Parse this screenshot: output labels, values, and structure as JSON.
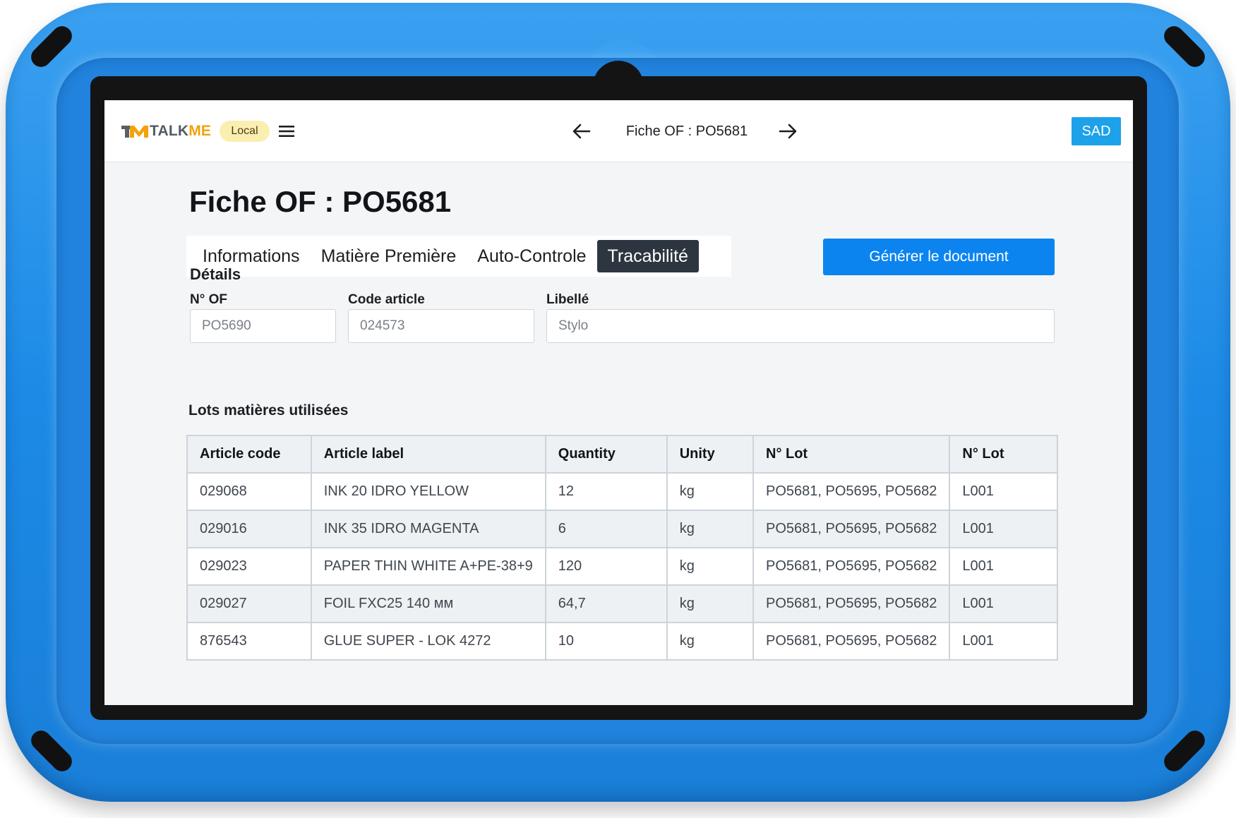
{
  "header": {
    "brand_part1": "TALK",
    "brand_part2": "ME",
    "env_badge": "Local",
    "title": "Fiche OF : PO5681",
    "user_initials": "SAD"
  },
  "page": {
    "title": "Fiche OF : PO5681",
    "tabs": [
      {
        "label": "Informations",
        "active": false
      },
      {
        "label": "Matière Première",
        "active": false
      },
      {
        "label": "Auto-Controle",
        "active": false
      },
      {
        "label": "Tracabilité",
        "active": true
      }
    ],
    "generate_button": "Générer le document"
  },
  "details": {
    "section_title": "Détails",
    "of_number": {
      "label": "N° OF",
      "placeholder": "PO5690"
    },
    "article_code": {
      "label": "Code article",
      "placeholder": "024573"
    },
    "libelle": {
      "label": "Libellé",
      "placeholder": "Stylo"
    }
  },
  "lots": {
    "section_title": "Lots matières utilisées",
    "columns": [
      "Article code",
      "Article label",
      "Quantity",
      "Unity",
      "N° Lot",
      "N° Lot"
    ],
    "rows": [
      [
        "029068",
        "INK 20 IDRO YELLOW",
        "12",
        "kg",
        "PO5681, PO5695, PO5682",
        "L001"
      ],
      [
        "029016",
        "INK 35 IDRO MAGENTA",
        "6",
        "kg",
        "PO5681, PO5695, PO5682",
        "L001"
      ],
      [
        "029023",
        "PAPER THIN WHITE A+PE-38+9",
        "120",
        "kg",
        "PO5681, PO5695, PO5682",
        "L001"
      ],
      [
        "029027",
        "FOIL FXC25 140 мм",
        "64,7",
        "kg",
        "PO5681, PO5695, PO5682",
        "L001"
      ],
      [
        "876543",
        "GLUE SUPER - LOK 4272",
        "10",
        "kg",
        "PO5681, PO5695, PO5682",
        "L001"
      ]
    ]
  },
  "colors": {
    "case_blue": "#1c8ae6",
    "primary_button": "#0b84f0",
    "user_badge": "#1da1e9",
    "active_tab": "#2d3540",
    "env_badge_bg": "#fbeeb1",
    "brand_orange": "#f3a20b"
  },
  "icons": {
    "menu": "hamburger-menu-icon",
    "prev": "arrow-left-icon",
    "next": "arrow-right-icon",
    "logo": "talkme-logo-icon"
  }
}
